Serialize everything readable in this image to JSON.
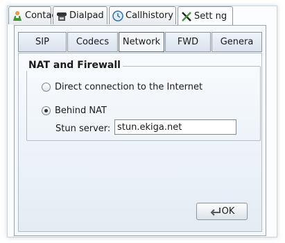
{
  "top_tabs": [
    {
      "label": "Contact",
      "icon": "contact-icon"
    },
    {
      "label": "Dialpad",
      "icon": "phone-icon"
    },
    {
      "label": "Callhistory",
      "icon": "callhistory-icon"
    },
    {
      "label": "Sett ng",
      "icon": "settings-icon"
    }
  ],
  "sub_tabs": [
    {
      "label": "SIP"
    },
    {
      "label": "Codecs"
    },
    {
      "label": "Network"
    },
    {
      "label": "FWD"
    },
    {
      "label": "Genera"
    }
  ],
  "active_top_tab": "Sett ng",
  "active_sub_tab": "Network",
  "nat": {
    "title": "NAT and Firewall",
    "option_direct": "Direct connection to the Internet",
    "option_behind": "Behind NAT",
    "stun_label": "Stun server:",
    "stun_value": "stun.ekiga.net"
  },
  "ok_label": "OK",
  "colors": {
    "accent_green": "#3f9a2e",
    "accent_blue": "#2f6fc0"
  }
}
